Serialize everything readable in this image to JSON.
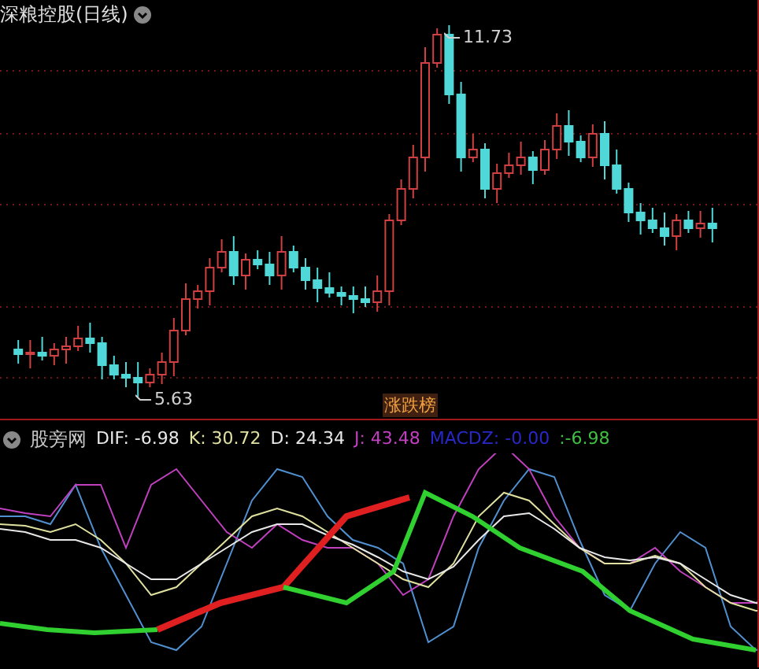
{
  "title": "深粮控股(日线)",
  "price_labels": [
    {
      "text": "11.73",
      "kind": "high"
    },
    {
      "text": "5.63",
      "kind": "low"
    }
  ],
  "badge": "涨跌榜",
  "indicator": {
    "name": "股旁网",
    "values": [
      {
        "text": "DIF: -6.98",
        "color": "#e8e8e8"
      },
      {
        "text": "K: 30.72",
        "color": "#e0e0a0"
      },
      {
        "text": "D: 24.34",
        "color": "#e8e8e8"
      },
      {
        "text": "J: 43.48",
        "color": "#c040c0"
      },
      {
        "text": "MACDZ: -0.00",
        "color": "#2828c8"
      },
      {
        "text": ":-6.98",
        "color": "#40c040"
      }
    ]
  }
}
